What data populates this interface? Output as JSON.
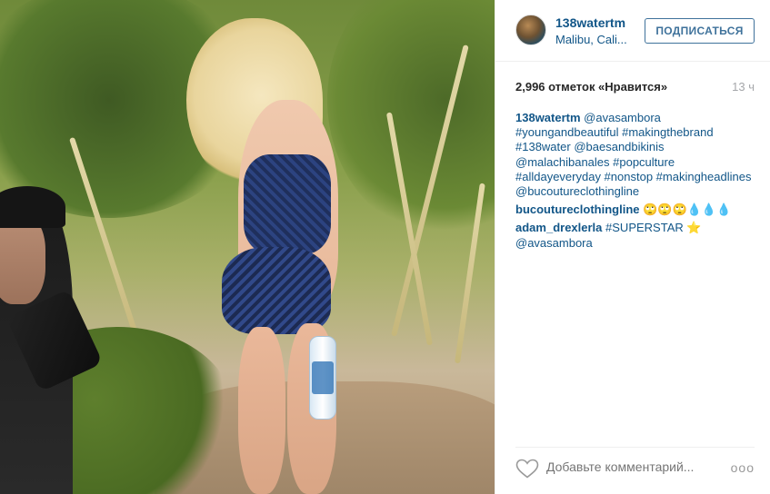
{
  "post": {
    "username": "138watertm",
    "location": "Malibu, Cali...",
    "follow_label": "ПОДПИСАТЬСЯ",
    "likes": "2,996 отметок «Нравится»",
    "time": "13 ч",
    "photo_icon": "photo"
  },
  "comments": [
    {
      "user": "138watertm",
      "text": "@avasambora #youngandbeautiful #makingthebrand #138water @baesandbikinis @malachibanales #popculture #alldayeveryday #nonstop #makingheadlines @bucoutureclothingline"
    },
    {
      "user": "bucoutureclothingline",
      "text": "🙄🙄🙄💧💧💧"
    },
    {
      "user": "adam_drexlerla",
      "text": "#SUPERSTAR ⭐ @avasambora"
    }
  ],
  "footer": {
    "comment_placeholder": "Добавьте комментарий...",
    "heart_icon": "heart-outline",
    "more_label": "ooo"
  }
}
